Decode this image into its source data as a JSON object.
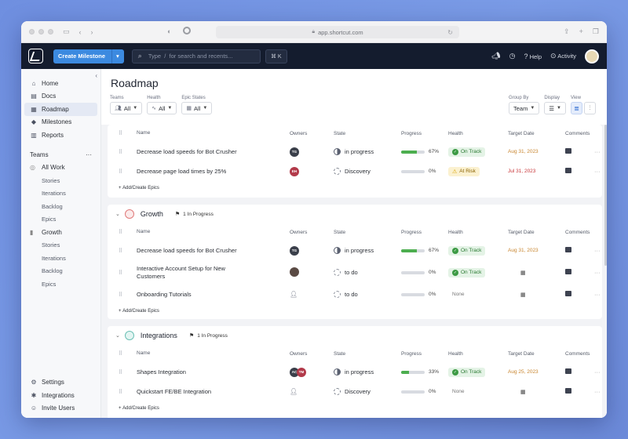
{
  "browser": {
    "url": "app.shortcut.com"
  },
  "topbar": {
    "create_label": "Create Milestone",
    "search_type": "Type",
    "search_slash": "/",
    "search_hint": "for search and recents...",
    "shortcut": "⌘ K",
    "help": "Help",
    "activity": "Activity"
  },
  "sidebar": {
    "nav": [
      {
        "label": "Home",
        "icon": "home-icon"
      },
      {
        "label": "Docs",
        "icon": "docs-icon"
      },
      {
        "label": "Roadmap",
        "icon": "roadmap-icon"
      },
      {
        "label": "Milestones",
        "icon": "milestones-icon"
      },
      {
        "label": "Reports",
        "icon": "reports-icon"
      }
    ],
    "teams_label": "Teams",
    "teams_more": "···",
    "all_work": "All Work",
    "all_work_items": [
      "Stories",
      "Iterations",
      "Backlog",
      "Epics"
    ],
    "growth": "Growth",
    "growth_items": [
      "Stories",
      "Iterations",
      "Backlog",
      "Epics"
    ],
    "bottom": [
      {
        "label": "Settings",
        "icon": "settings-icon"
      },
      {
        "label": "Integrations",
        "icon": "integrations-icon"
      },
      {
        "label": "Invite Users",
        "icon": "invite-users-icon"
      }
    ]
  },
  "page": {
    "title": "Roadmap",
    "filters": {
      "teams_label": "Teams",
      "teams_value": "All",
      "health_label": "Health",
      "health_value": "All",
      "epic_states_label": "Epic States",
      "epic_states_value": "All",
      "group_by_label": "Group By",
      "group_by_value": "Team",
      "display_label": "Display",
      "view_label": "View"
    }
  },
  "columns": {
    "name": "Name",
    "owners": "Owners",
    "state": "State",
    "progress": "Progress",
    "health": "Health",
    "target": "Target Date",
    "comments": "Comments"
  },
  "add_epics": "Add/Create Epics",
  "groups": [
    {
      "name": "",
      "rows": [
        {
          "name": "Decrease load speeds for Bot Crusher",
          "owners": [
            "TG"
          ],
          "state": "in progress",
          "progress": 0.67,
          "pct": "67%",
          "health": "On Track",
          "target": "Aug 31, 2023"
        },
        {
          "name": "Decrease page load times by 25%",
          "owners": [
            "EH"
          ],
          "state": "Discovery",
          "progress": 0,
          "pct": "0%",
          "health": "At Risk",
          "target": "Jul 31, 2023"
        }
      ]
    },
    {
      "name": "Growth",
      "badge": "1 In Progress",
      "rows": [
        {
          "name": "Decrease load speeds for Bot Crusher",
          "owners": [
            "TG"
          ],
          "state": "in progress",
          "progress": 0.67,
          "pct": "67%",
          "health": "On Track",
          "target": "Aug 31, 2023"
        },
        {
          "name": "Interactive Account Setup for New Customers",
          "owners": [
            "photo"
          ],
          "state": "to do",
          "progress": 0,
          "pct": "0%",
          "health": "On Track",
          "target": ""
        },
        {
          "name": "Onboarding Tutorials",
          "owners": [
            "person"
          ],
          "state": "to do",
          "progress": 0,
          "pct": "0%",
          "health": "None",
          "target": ""
        }
      ]
    },
    {
      "name": "Integrations",
      "badge": "1 In Progress",
      "rows": [
        {
          "name": "Shapes Integration",
          "owners": [
            "AC",
            "TM"
          ],
          "state": "in progress",
          "progress": 0.33,
          "pct": "33%",
          "health": "On Track",
          "target": "Aug 25, 2023"
        },
        {
          "name": "Quickstart FE/BE Integration",
          "owners": [
            "person"
          ],
          "state": "Discovery",
          "progress": 0,
          "pct": "0%",
          "health": "None",
          "target": ""
        }
      ]
    }
  ],
  "colors": {
    "topbar_bg": "#141c2e",
    "accent": "#3c8ae0",
    "on_track_bg": "#e4f3e6",
    "at_risk_bg": "#fbf1d0",
    "progress_green": "#4cae4f"
  }
}
